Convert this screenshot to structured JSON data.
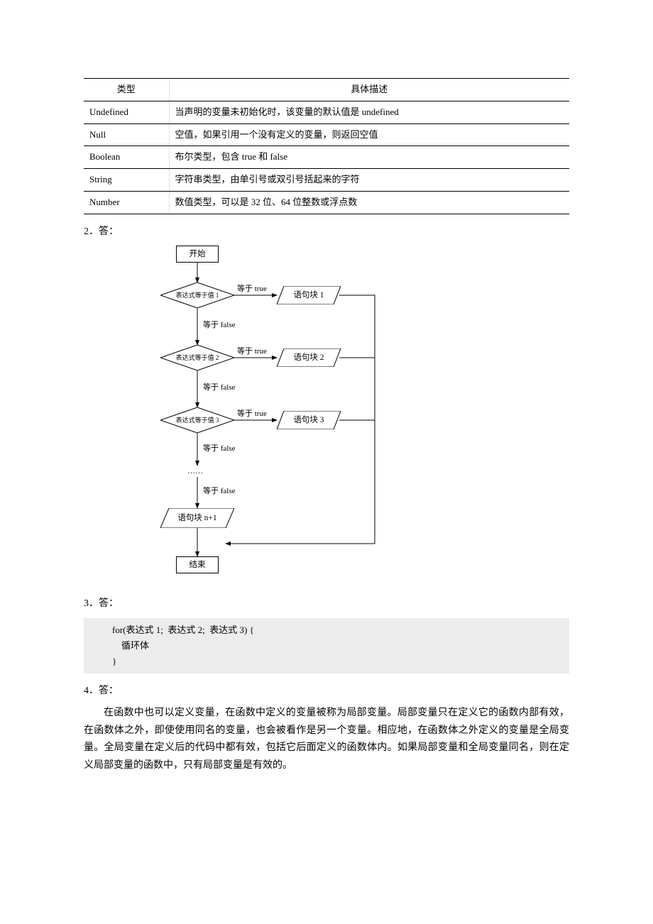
{
  "table": {
    "headers": [
      "类型",
      "具体描述"
    ],
    "rows": [
      [
        "Undefined",
        "当声明的变量未初始化时，该变量的默认值是 undefined"
      ],
      [
        "Null",
        "空值，如果引用一个没有定义的变量，则返回空值"
      ],
      [
        "Boolean",
        "布尔类型，包含 true 和 false"
      ],
      [
        "String",
        "字符串类型，由单引号或双引号括起来的字符"
      ],
      [
        "Number",
        "数值类型，可以是 32 位、64 位整数或浮点数"
      ]
    ]
  },
  "answers": {
    "a2": "2．答：",
    "a3": "3．答：",
    "a4": "4．答："
  },
  "chart_data": {
    "type": "flowchart",
    "nodes": [
      {
        "id": "start",
        "shape": "rect",
        "label": "开始"
      },
      {
        "id": "c1",
        "shape": "diamond",
        "label": "表达式等于值 1"
      },
      {
        "id": "b1",
        "shape": "parallelogram",
        "label": "语句块 1"
      },
      {
        "id": "c2",
        "shape": "diamond",
        "label": "表达式等于值 2"
      },
      {
        "id": "b2",
        "shape": "parallelogram",
        "label": "语句块 2"
      },
      {
        "id": "c3",
        "shape": "diamond",
        "label": "表达式等于值 3"
      },
      {
        "id": "b3",
        "shape": "parallelogram",
        "label": "语句块 3"
      },
      {
        "id": "dots",
        "shape": "text",
        "label": "……"
      },
      {
        "id": "bn",
        "shape": "parallelogram",
        "label": "语句块 n+1"
      },
      {
        "id": "end",
        "shape": "rect",
        "label": "结束"
      }
    ],
    "edges": [
      {
        "from": "start",
        "to": "c1"
      },
      {
        "from": "c1",
        "to": "b1",
        "label": "等于 true"
      },
      {
        "from": "c1",
        "to": "c2",
        "label": "等于 false"
      },
      {
        "from": "c2",
        "to": "b2",
        "label": "等于 true"
      },
      {
        "from": "c2",
        "to": "c3",
        "label": "等于 false"
      },
      {
        "from": "c3",
        "to": "b3",
        "label": "等于 true"
      },
      {
        "from": "c3",
        "to": "dots",
        "label": "等于 false"
      },
      {
        "from": "dots",
        "to": "bn",
        "label": "等于 false"
      },
      {
        "from": "bn",
        "to": "end"
      },
      {
        "from": "b1",
        "to": "end",
        "via": "right"
      },
      {
        "from": "b2",
        "to": "end",
        "via": "right"
      },
      {
        "from": "b3",
        "to": "end",
        "via": "right"
      }
    ],
    "labels": {
      "true": "等于 true",
      "false": "等于 false"
    }
  },
  "code": {
    "line1a": "for(",
    "line1b": "表达式",
    "line1c": " 1;  ",
    "line1d": "表达式",
    "line1e": " 2;  ",
    "line1f": "表达式",
    "line1g": " 3) {",
    "line2": "循环体",
    "line3": "}"
  },
  "paragraph": "在函数中也可以定义变量，在函数中定义的变量被称为局部变量。局部变量只在定义它的函数内部有效，在函数体之外，即使使用同名的变量，也会被看作是另一个变量。相应地，在函数体之外定义的变量是全局变量。全局变量在定义后的代码中都有效，包括它后面定义的函数体内。如果局部变量和全局变量同名，则在定义局部变量的函数中，只有局部变量是有效的。"
}
